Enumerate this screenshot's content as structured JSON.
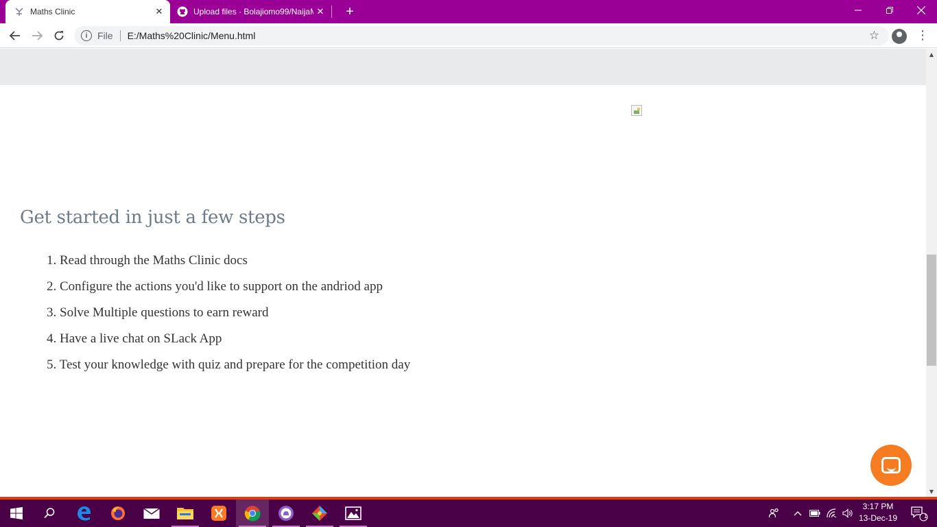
{
  "browser": {
    "tabs": [
      {
        "title": "Maths Clinic",
        "active": true,
        "favicon": "maths-clinic-icon"
      },
      {
        "title": "Upload files · Bolajiomo99/NaijaM",
        "active": false,
        "favicon": "github-icon"
      }
    ],
    "new_tab_label": "+",
    "url_scheme": "File",
    "url": "E:/Maths%20Clinic/Menu.html",
    "accent_color": "#9b0096"
  },
  "page": {
    "steps_title": "Get started in just a few steps",
    "steps": [
      {
        "num": "1.",
        "text": "Read through the Maths Clinic docs"
      },
      {
        "num": "2.",
        "text": "Configure the actions you'd like to support on the andriod app"
      },
      {
        "num": "3.",
        "text": "Solve Multiple questions to earn reward"
      },
      {
        "num": "4.",
        "text": "Have a live chat on SLack App"
      },
      {
        "num": "5.",
        "text": "Test your knowledge with quiz and prepare for the competition day"
      }
    ],
    "chat_button_color": "#f57c20"
  },
  "taskbar": {
    "apps": [
      "start-icon",
      "search-icon",
      "edge-icon",
      "firefox-icon",
      "mail-icon",
      "file-explorer-icon",
      "xampp-icon",
      "chrome-icon",
      "github-desktop-icon",
      "git-icon",
      "photos-icon"
    ],
    "time": "3:17 PM",
    "date": "13-Dec-19",
    "notification_count": "1"
  }
}
